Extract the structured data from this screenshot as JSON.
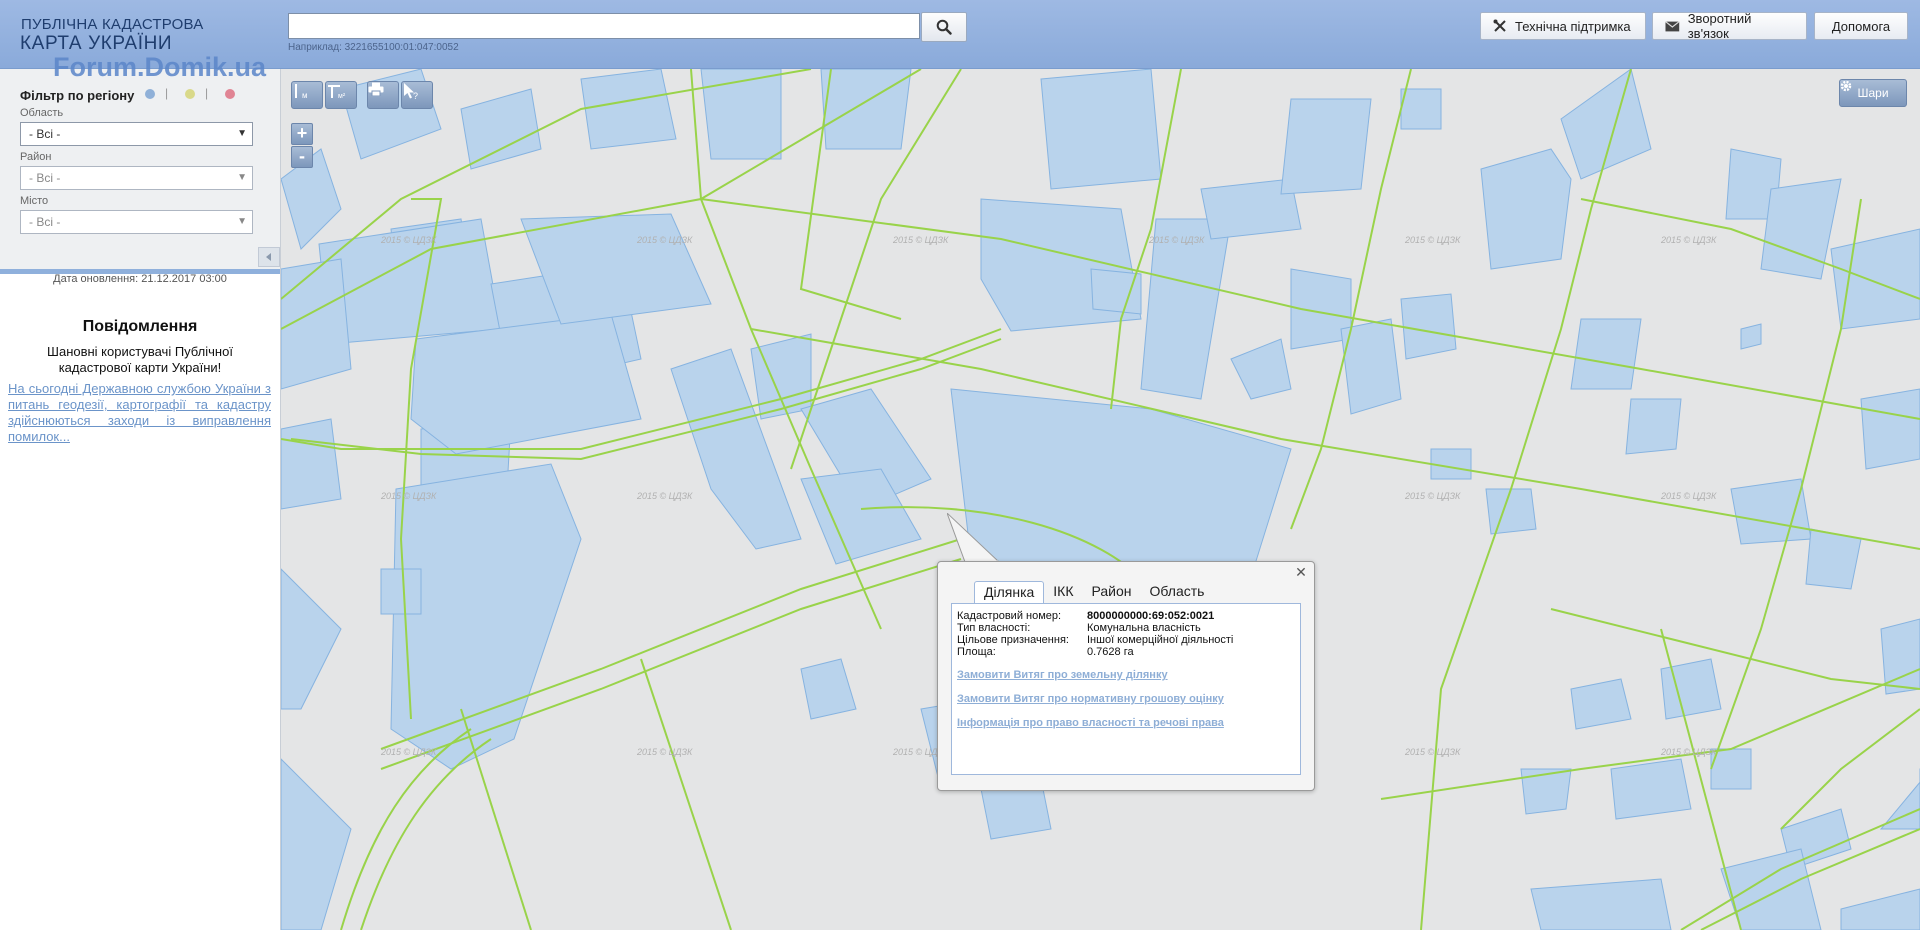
{
  "header": {
    "logo_line1": "ПУБЛІЧНА КАДАСТРОВА",
    "logo_line2": "КАРТА УКРАЇНИ",
    "watermark": "Forum.Domik.ua",
    "search_value": "",
    "search_hint": "Наприклад: 3221655100:01:047:0052",
    "support_label": "Технічна підтримка",
    "feedback_label": "Зворотний зв'язок",
    "help_label": "Допомога"
  },
  "sidebar": {
    "filter_title": "Фільтр по регіону",
    "dot_colors": [
      "#8fb0d8",
      "#d9d98a",
      "#e08494"
    ],
    "region_label": "Область",
    "region_value": "- Всі -",
    "district_label": "Район",
    "district_value": "- Всі -",
    "city_label": "Місто",
    "city_value": "- Всі -",
    "update_date": "Дата оновлення: 21.12.2017 03:00",
    "message_title": "Повідомлення",
    "message_greeting": "Шановні користувачі Публічної кадастрової карти України!",
    "message_link": "На сьогодні Державною службою України з питань геодезії, картографії та кадастру здійснюються заходи із виправлення помилок..."
  },
  "map": {
    "layers_label": "Шари",
    "zoom_in": "+",
    "zoom_out": "-",
    "copyright": "2015 © ЦДЗК",
    "tools": [
      "ruler-distance-icon",
      "ruler-area-icon",
      "print-icon",
      "identify-cursor-icon"
    ],
    "colors": {
      "background": "#e4e5e6",
      "parcel_fill": "#b9d3ec",
      "parcel_stroke": "#86b3e0",
      "road": "#99d34a"
    }
  },
  "popup": {
    "tabs": [
      "Ділянка",
      "ІКК",
      "Район",
      "Область"
    ],
    "active_tab": "Ділянка",
    "rows": [
      {
        "label": "Кадастровий номер:",
        "value": "8000000000:69:052:0021"
      },
      {
        "label": "Тип власності:",
        "value": "Комунальна власність"
      },
      {
        "label": "Цільове призначення:",
        "value": "Іншої комерційної діяльності"
      },
      {
        "label": "Площа:",
        "value": "0.7628 га"
      }
    ],
    "links": [
      "Замовити Витяг про земельну ділянку",
      "Замовити Витяг про нормативну грошову оцінку",
      "Інформація про право власності та речові права"
    ]
  }
}
